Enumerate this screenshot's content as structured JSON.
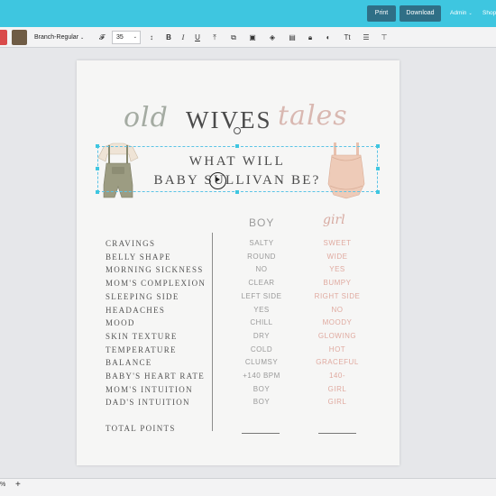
{
  "topbar": {
    "print_label": "Print",
    "download_label": "Download",
    "admin_label": "Admin",
    "shop_label": "Shop",
    "color": "#3ec6e0"
  },
  "toolbar": {
    "font_name": "Branch-Regular",
    "font_size": "35",
    "text_color": "#6f5c45"
  },
  "document": {
    "title_old": "old",
    "title_wives": "WIVES",
    "title_tales": "tales",
    "heading_line1": "WHAT WILL",
    "heading_line2": "BABY SULLIVAN BE?",
    "col_boy": "BOY",
    "col_girl": "girl",
    "rows": [
      {
        "label": "CRAVINGS",
        "boy": "SALTY",
        "girl": "SWEET"
      },
      {
        "label": "BELLY SHAPE",
        "boy": "ROUND",
        "girl": "WIDE"
      },
      {
        "label": "MORNING SICKNESS",
        "boy": "NO",
        "girl": "YES"
      },
      {
        "label": "MOM'S COMPLEXION",
        "boy": "CLEAR",
        "girl": "BUMPY"
      },
      {
        "label": "SLEEPING SIDE",
        "boy": "LEFT SIDE",
        "girl": "RIGHT SIDE"
      },
      {
        "label": "HEADACHES",
        "boy": "YES",
        "girl": "NO"
      },
      {
        "label": "MOOD",
        "boy": "CHILL",
        "girl": "MOODY"
      },
      {
        "label": "SKIN TEXTURE",
        "boy": "DRY",
        "girl": "GLOWING"
      },
      {
        "label": "TEMPERATURE",
        "boy": "COLD",
        "girl": "HOT"
      },
      {
        "label": "BALANCE",
        "boy": "CLUMSY",
        "girl": "GRACEFUL"
      },
      {
        "label": "BABY'S HEART RATE",
        "boy": "+140 BPM",
        "girl": "140-"
      },
      {
        "label": "MOM'S INTUITION",
        "boy": "BOY",
        "girl": "GIRL"
      },
      {
        "label": "DAD'S INTUITION",
        "boy": "BOY",
        "girl": "GIRL"
      }
    ],
    "total_label": "TOTAL POINTS"
  },
  "bottombar": {
    "zoom_text": "%",
    "zoom_in_symbol": "+"
  }
}
